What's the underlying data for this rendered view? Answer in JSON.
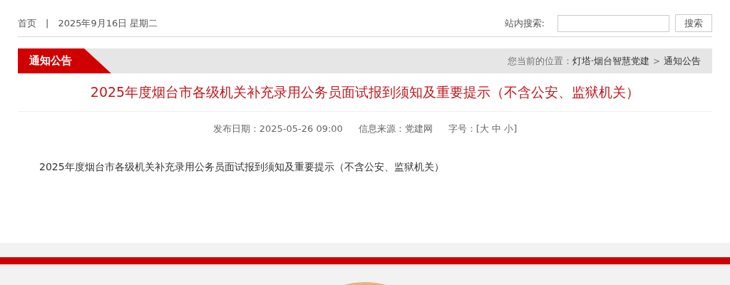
{
  "top_bar": {
    "home_link": "首页",
    "separator": "|",
    "date": "2025年9月16日 星期二",
    "search_label": "站内搜索:",
    "search_button": "搜索"
  },
  "section_bar": {
    "title": "通知公告",
    "location_label": "您当前的位置：",
    "breadcrumbs": [
      {
        "label": "灯塔·烟台智慧党建"
      },
      {
        "label": "通知公告"
      }
    ],
    "breadcrumb_separator": ">"
  },
  "article": {
    "title": "2025年度烟台市各级机关补充录用公务员面试报到须知及重要提示（不含公安、监狱机关）",
    "publish_date": "发布日期：2025-05-26 09:00",
    "source": "信息来源：党建网",
    "font_size": "字号：[大 中 小]",
    "body": "2025年度烟台市各级机关补充录用公务员面试报到须知及重要提示（不含公安、监狱机关）"
  }
}
